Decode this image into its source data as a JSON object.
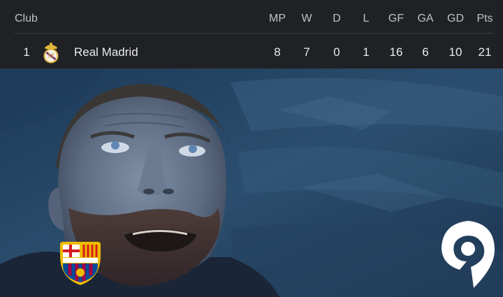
{
  "table": {
    "headers": {
      "club": "Club",
      "mp": "MP",
      "w": "W",
      "d": "D",
      "l": "L",
      "gf": "GF",
      "ga": "GA",
      "gd": "GD",
      "pts": "Pts"
    },
    "row": {
      "position": "1",
      "club_name": "Real Madrid",
      "crest_icon": "real-madrid-crest-icon",
      "mp": "8",
      "w": "7",
      "d": "0",
      "l": "1",
      "gf": "16",
      "ga": "6",
      "gd": "10",
      "pts": "21"
    }
  },
  "overlay": {
    "badge_icon": "fc-barcelona-crest-icon",
    "watermark_icon": "location-pin-watermark-icon"
  },
  "colors": {
    "table_bg": "#202124",
    "table_text": "#e8eaed",
    "header_text": "#bdc1c6",
    "scene_blue": "#2c4e6e",
    "fcb_blue": "#004d98",
    "fcb_red": "#a50044",
    "fcb_gold": "#edbb00"
  }
}
